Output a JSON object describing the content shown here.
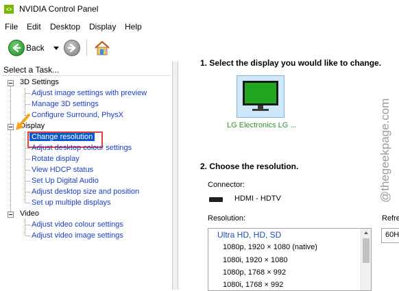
{
  "window": {
    "title": "NVIDIA Control Panel",
    "app_icon": "nvidia-logo-icon"
  },
  "menu": [
    "File",
    "Edit",
    "Desktop",
    "Display",
    "Help"
  ],
  "toolbar": {
    "back_label": "Back",
    "back_icon": "back-arrow-icon",
    "forward_icon": "forward-arrow-icon",
    "home_icon": "home-icon"
  },
  "task_pane": {
    "header": "Select a Task...",
    "categories": [
      {
        "label": "3D Settings",
        "items": [
          "Adjust image settings with preview",
          "Manage 3D settings",
          "Configure Surround, PhysX"
        ]
      },
      {
        "label": "Display",
        "items": [
          "Change resolution",
          "Adjust desktop colour settings",
          "Rotate display",
          "View HDCP status",
          "Set Up Digital Audio",
          "Adjust desktop size and position",
          "Set up multiple displays"
        ]
      },
      {
        "label": "Video",
        "items": [
          "Adjust video colour settings",
          "Adjust video image settings"
        ]
      }
    ],
    "selected_item": "Change resolution"
  },
  "content": {
    "section1_title": "1. Select the display you would like to change.",
    "display_name": "LG Electronics LG ...",
    "section2_title": "2. Choose the resolution.",
    "connector_label": "Connector:",
    "connector_value": "HDMI - HDTV",
    "connector_icon": "hdmi-icon",
    "resolution_label": "Resolution:",
    "resolution_group": "Ultra HD, HD, SD",
    "resolutions": [
      "1080p, 1920 × 1080 (native)",
      "1080i, 1920 × 1080",
      "1080p, 1768 × 992",
      "1080i, 1768 × 992"
    ],
    "refresh_label": "Refre",
    "refresh_value": "60H:"
  },
  "watermark": "@thegeekpage.com",
  "colors": {
    "link": "#1a3cc8",
    "selected_bg": "#0b58c9",
    "highlight_box": "#e04040",
    "pointer": "#f5a31a",
    "display_label": "#2f8f2f"
  }
}
